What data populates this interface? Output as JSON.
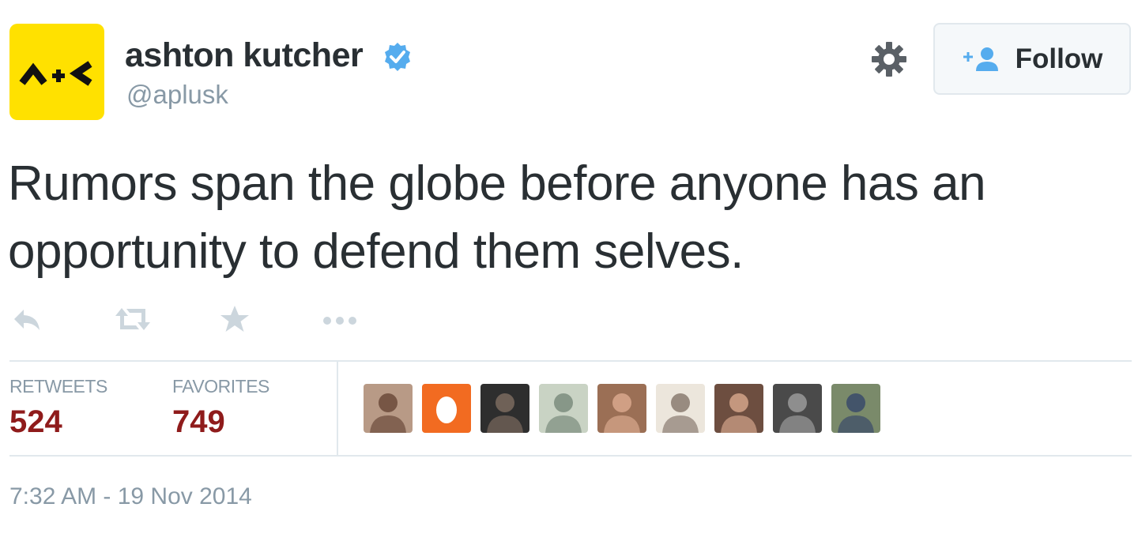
{
  "user": {
    "name": "ashton kutcher",
    "handle": "@aplusk",
    "avatar_icon": "aplusk-logo",
    "avatar_color": "#FFE100",
    "verified_color": "#55ACEE"
  },
  "follow_button": {
    "label": "Follow",
    "icon": "add-user-icon"
  },
  "tweet": {
    "text": "Rumors span the globe before anyone has an opportunity to defend them selves."
  },
  "actions": [
    "reply-icon",
    "retweet-icon",
    "favorite-icon",
    "more-icon"
  ],
  "stats": {
    "retweets_label": "RETWEETS",
    "retweets_value": "524",
    "favorites_label": "FAVORITES",
    "favorites_value": "749"
  },
  "favoriters": [
    {
      "name": "favoriter-avatar-1",
      "bg": "#b89a86",
      "fg": "#6b4a3a"
    },
    {
      "name": "favoriter-avatar-2",
      "bg": "#f26b21",
      "fg": "#ffffff"
    },
    {
      "name": "favoriter-avatar-3",
      "bg": "#2e2e2e",
      "fg": "#7a6a5e"
    },
    {
      "name": "favoriter-avatar-4",
      "bg": "#c9d3c4",
      "fg": "#7b8c7e"
    },
    {
      "name": "favoriter-avatar-5",
      "bg": "#9b6f55",
      "fg": "#d9a88d"
    },
    {
      "name": "favoriter-avatar-6",
      "bg": "#ece6dc",
      "fg": "#8a7a70"
    },
    {
      "name": "favoriter-avatar-7",
      "bg": "#6d4e40",
      "fg": "#d3a48a"
    },
    {
      "name": "favoriter-avatar-8",
      "bg": "#4a4a4a",
      "fg": "#9a9a9a"
    },
    {
      "name": "favoriter-avatar-9",
      "bg": "#7a8a6a",
      "fg": "#3a4a6a"
    }
  ],
  "timestamp": "7:32 AM - 19 Nov 2014",
  "colors": {
    "text": "#292f33",
    "muted": "#8899a6",
    "stat_value": "#8f1b1b",
    "divider": "#e1e8ed",
    "action_icon": "#ccd6dd"
  }
}
